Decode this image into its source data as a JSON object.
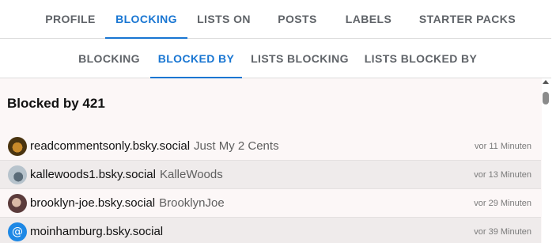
{
  "primary_tabs": [
    {
      "label": "PROFILE"
    },
    {
      "label": "BLOCKING"
    },
    {
      "label": "LISTS ON"
    },
    {
      "label": "POSTS"
    },
    {
      "label": "LABELS"
    },
    {
      "label": "STARTER PACKS"
    }
  ],
  "secondary_tabs": [
    {
      "label": "BLOCKING"
    },
    {
      "label": "BLOCKED BY"
    },
    {
      "label": "LISTS BLOCKING"
    },
    {
      "label": "LISTS BLOCKED BY"
    }
  ],
  "accent_color": "#1976d2",
  "heading": "Blocked by 421",
  "rows": [
    {
      "handle": "readcommentsonly.bsky.social",
      "display_name": "Just My 2 Cents",
      "time": "vor 11 Minuten",
      "avatar": "avatar-image"
    },
    {
      "handle": "kallewoods1.bsky.social",
      "display_name": "KalleWoods",
      "time": "vor 13 Minuten",
      "avatar": "avatar-image"
    },
    {
      "handle": "brooklyn-joe.bsky.social",
      "display_name": "BrooklynJoe",
      "time": "vor 29 Minuten",
      "avatar": "avatar-image"
    },
    {
      "handle": "moinhamburg.bsky.social",
      "display_name": "",
      "time": "vor 39 Minuten",
      "avatar": "at-sign-icon",
      "avatar_glyph": "@"
    }
  ]
}
